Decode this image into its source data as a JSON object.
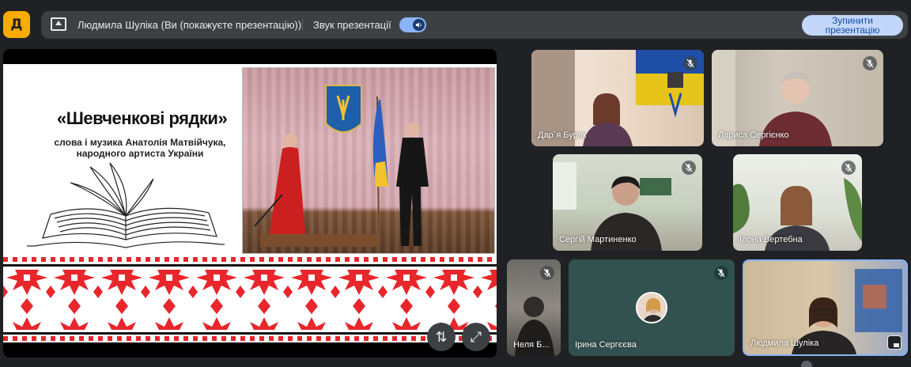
{
  "app_logo": {
    "glyph": "Д"
  },
  "present_bar": {
    "text": "Людмила Шуліка (Ви (покажуєте презентацію))",
    "sound_label": "Звук презентації",
    "sound_on": true,
    "stop_button": "Зупинити\nпрезентацію"
  },
  "slide": {
    "title": "«Шевченкові рядки»",
    "subtitle_line1": "слова і музика Анатолія Матвійчука,",
    "subtitle_line2": "народного артиста України"
  },
  "stage_controls": [
    {
      "name": "swap-layout-button",
      "glyph": "⇅"
    },
    {
      "name": "fullscreen-button",
      "glyph": "⤢"
    }
  ],
  "participants": [
    {
      "name": "Дар`я Буряк",
      "muted": true
    },
    {
      "name": "Лариса Сергієнко",
      "muted": true
    },
    {
      "name": "Сергій Мартиненко",
      "muted": true
    },
    {
      "name": "Ілона Вертебна",
      "muted": true
    },
    {
      "name": "Неля Б...",
      "muted": true
    },
    {
      "name": "Ірина Сергєєва",
      "muted": true
    },
    {
      "name": "Людмила Шуліка",
      "muted": false
    }
  ],
  "colors": {
    "background": "#202124",
    "bar": "#3c4043",
    "accent": "#8ab4f8",
    "logo": "#f9ab00",
    "embroidery": "#e8262b"
  }
}
